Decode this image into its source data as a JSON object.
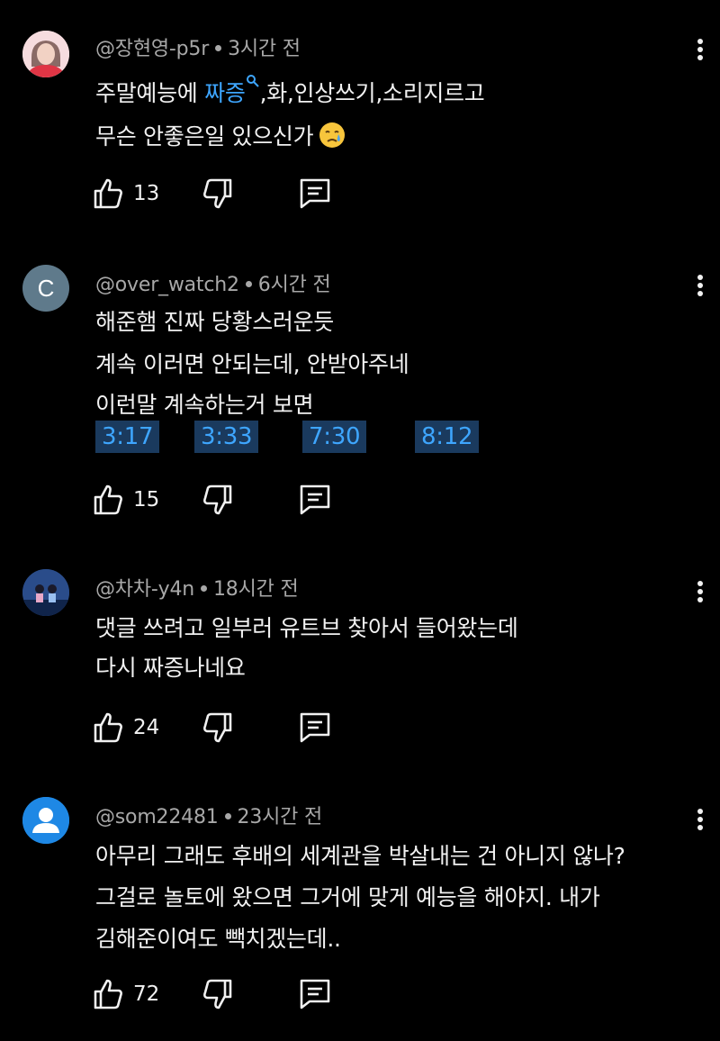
{
  "comments": [
    {
      "author": "@장현영-p5r",
      "time": "3시간 전",
      "line1_pre": "주말예능에 ",
      "line1_link": "짜증",
      "line1_post": ",화,인상쓰기,소리지르고",
      "line2": "무슨 안좋은일 있으신가",
      "likes": "13",
      "avatar": "person-photo"
    },
    {
      "author": "@over_watch2",
      "time": "6시간 전",
      "avatar_letter": "C",
      "lines": [
        "해준햄 진짜 당황스러운듯",
        "계속 이러면 안되는데, 안받아주네",
        "이런말 계속하는거 보면"
      ],
      "timestamps": [
        "3:17",
        "3:33",
        "7:30",
        "8:12"
      ],
      "likes": "15"
    },
    {
      "author": "@차차-y4n",
      "time": "18시간 전",
      "lines": [
        "댓글 쓰려고 일부러 유트브 찾아서  들어왔는데",
        "다시 짜증나네요"
      ],
      "likes": "24",
      "avatar": "illustration"
    },
    {
      "author": "@som22481",
      "time": "23시간 전",
      "lines": [
        "아무리 그래도 후배의 세계관을 박살내는 건 아니지 않나?",
        "그걸로 놀토에 왔으면 그거에 맞게 예능을 해야지. 내가",
        "김해준이여도 빽치겠는데.."
      ],
      "likes": "72",
      "avatar": "default-user"
    }
  ],
  "colors": {
    "background": "#000000",
    "text": "#f1f1f1",
    "meta": "#a8a8a8",
    "link": "#3ea6ff",
    "timestamp_bg": "#1a3a5e"
  },
  "icons": [
    "like-icon",
    "dislike-icon",
    "reply-icon",
    "more-options-icon",
    "search-icon",
    "crying-face-emoji"
  ]
}
